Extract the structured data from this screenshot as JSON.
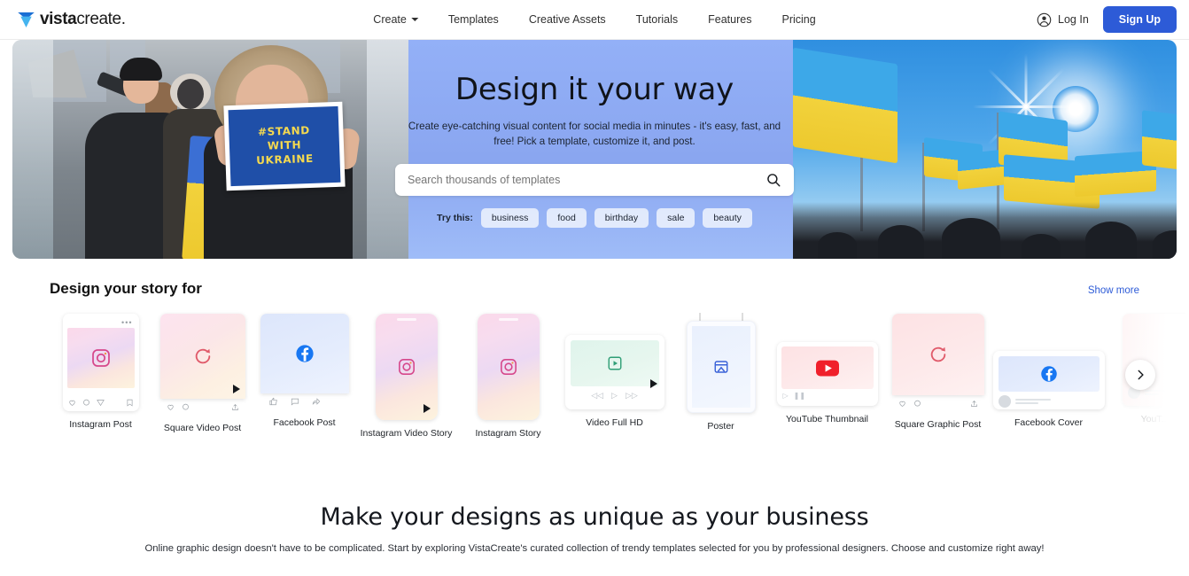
{
  "header": {
    "logo_text_bold": "vista",
    "logo_text_light": "create.",
    "nav": [
      {
        "label": "Create",
        "has_caret": true
      },
      {
        "label": "Templates",
        "has_caret": false
      },
      {
        "label": "Creative Assets",
        "has_caret": false
      },
      {
        "label": "Tutorials",
        "has_caret": false
      },
      {
        "label": "Features",
        "has_caret": false
      },
      {
        "label": "Pricing",
        "has_caret": false
      }
    ],
    "login_label": "Log In",
    "signup_label": "Sign Up",
    "signup_color": "#2d5bd7"
  },
  "hero": {
    "title": "Design it your way",
    "subtitle": "Create eye-catching visual content for social media in minutes - it's easy, fast, and free! Pick a template, customize it, and post.",
    "search_placeholder": "Search thousands of templates",
    "search_value": "",
    "try_label": "Try this:",
    "chips": [
      "business",
      "food",
      "birthday",
      "sale",
      "beauty"
    ],
    "left_image_alt": "protest photo with megaphone and sign",
    "sign_lines": [
      "#STAND",
      "WITH",
      "UKRAINE"
    ],
    "right_image_alt": "Ukrainian flags against blue sky",
    "overlay_color": "#8ca8f0"
  },
  "templates_section": {
    "title": "Design your story for",
    "show_more": "Show more",
    "cards": [
      {
        "label": "Instagram Post",
        "kind": "ig-post"
      },
      {
        "label": "Square Video Post",
        "kind": "square-video"
      },
      {
        "label": "Facebook Post",
        "kind": "fb-post"
      },
      {
        "label": "Instagram Video Story",
        "kind": "ig-video-story"
      },
      {
        "label": "Instagram Story",
        "kind": "ig-story"
      },
      {
        "label": "Video Full HD",
        "kind": "video-hd"
      },
      {
        "label": "Poster",
        "kind": "poster"
      },
      {
        "label": "YouTube Thumbnail",
        "kind": "youtube-thumb"
      },
      {
        "label": "Square Graphic Post",
        "kind": "square-graphic"
      },
      {
        "label": "Facebook Cover",
        "kind": "fb-cover"
      },
      {
        "label": "YouT...",
        "kind": "youtube-partial"
      }
    ]
  },
  "bottom": {
    "title": "Make your designs as unique as your business",
    "subtitle": "Online graphic design doesn't have to be complicated. Start by exploring VistaCreate's curated collection of trendy templates selected for you by professional designers. Choose and customize right away!"
  }
}
